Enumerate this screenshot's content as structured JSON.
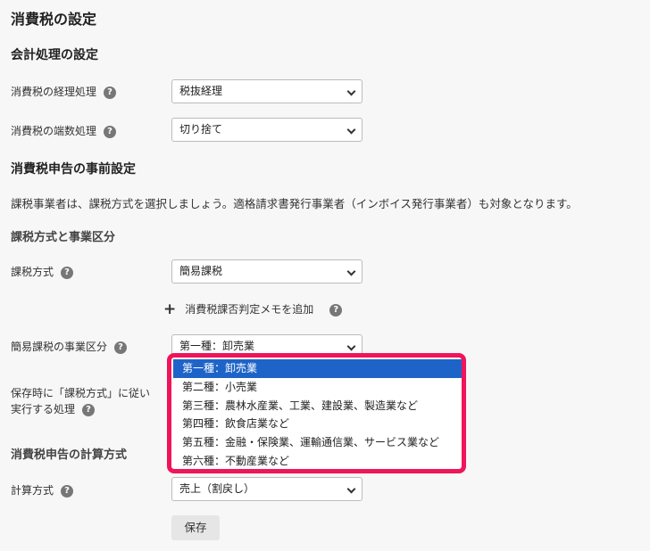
{
  "page_title": "消費税の設定",
  "section_accounting": {
    "title": "会計処理の設定",
    "tax_accounting": {
      "label": "消費税の経理処理",
      "value": "税抜経理"
    },
    "rounding": {
      "label": "消費税の端数処理",
      "value": "切り捨て"
    }
  },
  "section_declaration": {
    "title": "消費税申告の事前設定",
    "description": "課税事業者は、課税方式を選択しましょう。適格請求書発行事業者（インボイス発行事業者）も対象となります。",
    "subtitle_method": "課税方式と事業区分",
    "tax_method": {
      "label": "課税方式",
      "value": "簡易課税"
    },
    "add_memo_label": "消費税課否判定メモを追加",
    "business_category": {
      "label": "簡易課税の事業区分",
      "value": "第一種：卸売業",
      "options": [
        "第一種：卸売業",
        "第二種：小売業",
        "第三種：農林水産業、工業、建設業、製造業など",
        "第四種：飲食店業など",
        "第五種：金融・保険業、運輸通信業、サービス業など",
        "第六種：不動産業など"
      ],
      "selected_index": 0
    },
    "on_save_label_line1": "保存時に「課税方式」に従い",
    "on_save_label_line2": "実行する処理",
    "subtitle_calc": "消費税申告の計算方式",
    "calc_method": {
      "label": "計算方式",
      "value": "売上（割戻し）"
    }
  },
  "save_label": "保存",
  "help_glyph": "?",
  "icons": {
    "help": "help-circle-icon",
    "plus": "plus-icon",
    "chevron": "chevron-down-icon"
  },
  "colors": {
    "highlight_border": "#f0145a",
    "selected_option": "#1e64c8"
  }
}
